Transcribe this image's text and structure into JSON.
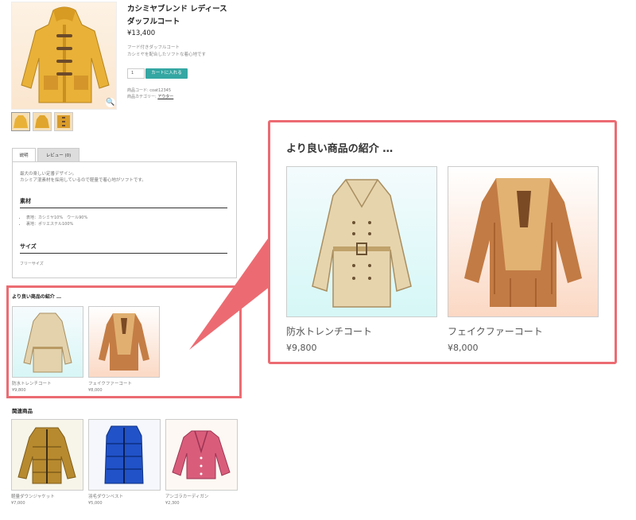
{
  "product": {
    "title": "カシミヤブレンド レディースダッフルコート",
    "price": "¥13,400",
    "desc_line1": "フード付きダッフルコート",
    "desc_line2": "カシミヤを配合したソフトな着心地です",
    "qty": "1",
    "add_to_cart": "カートに入れる",
    "sku_label": "商品コード: coat12345",
    "category_label": "商品カテゴリー:",
    "category_link": "アウター",
    "zoom_icon": "🔍"
  },
  "tabs": {
    "description": "説明",
    "reviews": "レビュー (0)"
  },
  "description": {
    "line1": "最大の楽しい定番デザイン。",
    "line2": "カシミア混素材を採用しているので軽量で着心地がソフトです。",
    "material_heading": "素材",
    "material_items": [
      "表地：カシミヤ10%　ウール90%",
      "裏地：ポリエステル100%"
    ],
    "size_heading": "サイズ",
    "size_value": "フリーサイズ"
  },
  "upsell": {
    "heading": "より良い商品の紹介 …",
    "items": [
      {
        "name": "防水トレンチコート",
        "price": "¥9,800"
      },
      {
        "name": "フェイクファーコート",
        "price": "¥8,000"
      }
    ]
  },
  "related": {
    "heading": "関連商品",
    "items": [
      {
        "name": "軽量ダウンジャケット",
        "price": "¥7,000"
      },
      {
        "name": "羽毛ダウンベスト",
        "price": "¥5,000"
      },
      {
        "name": "アンゴラカーディガン",
        "price": "¥2,300"
      }
    ]
  },
  "colors": {
    "accent": "#ec6b72",
    "cart_button": "#35a7a3"
  }
}
